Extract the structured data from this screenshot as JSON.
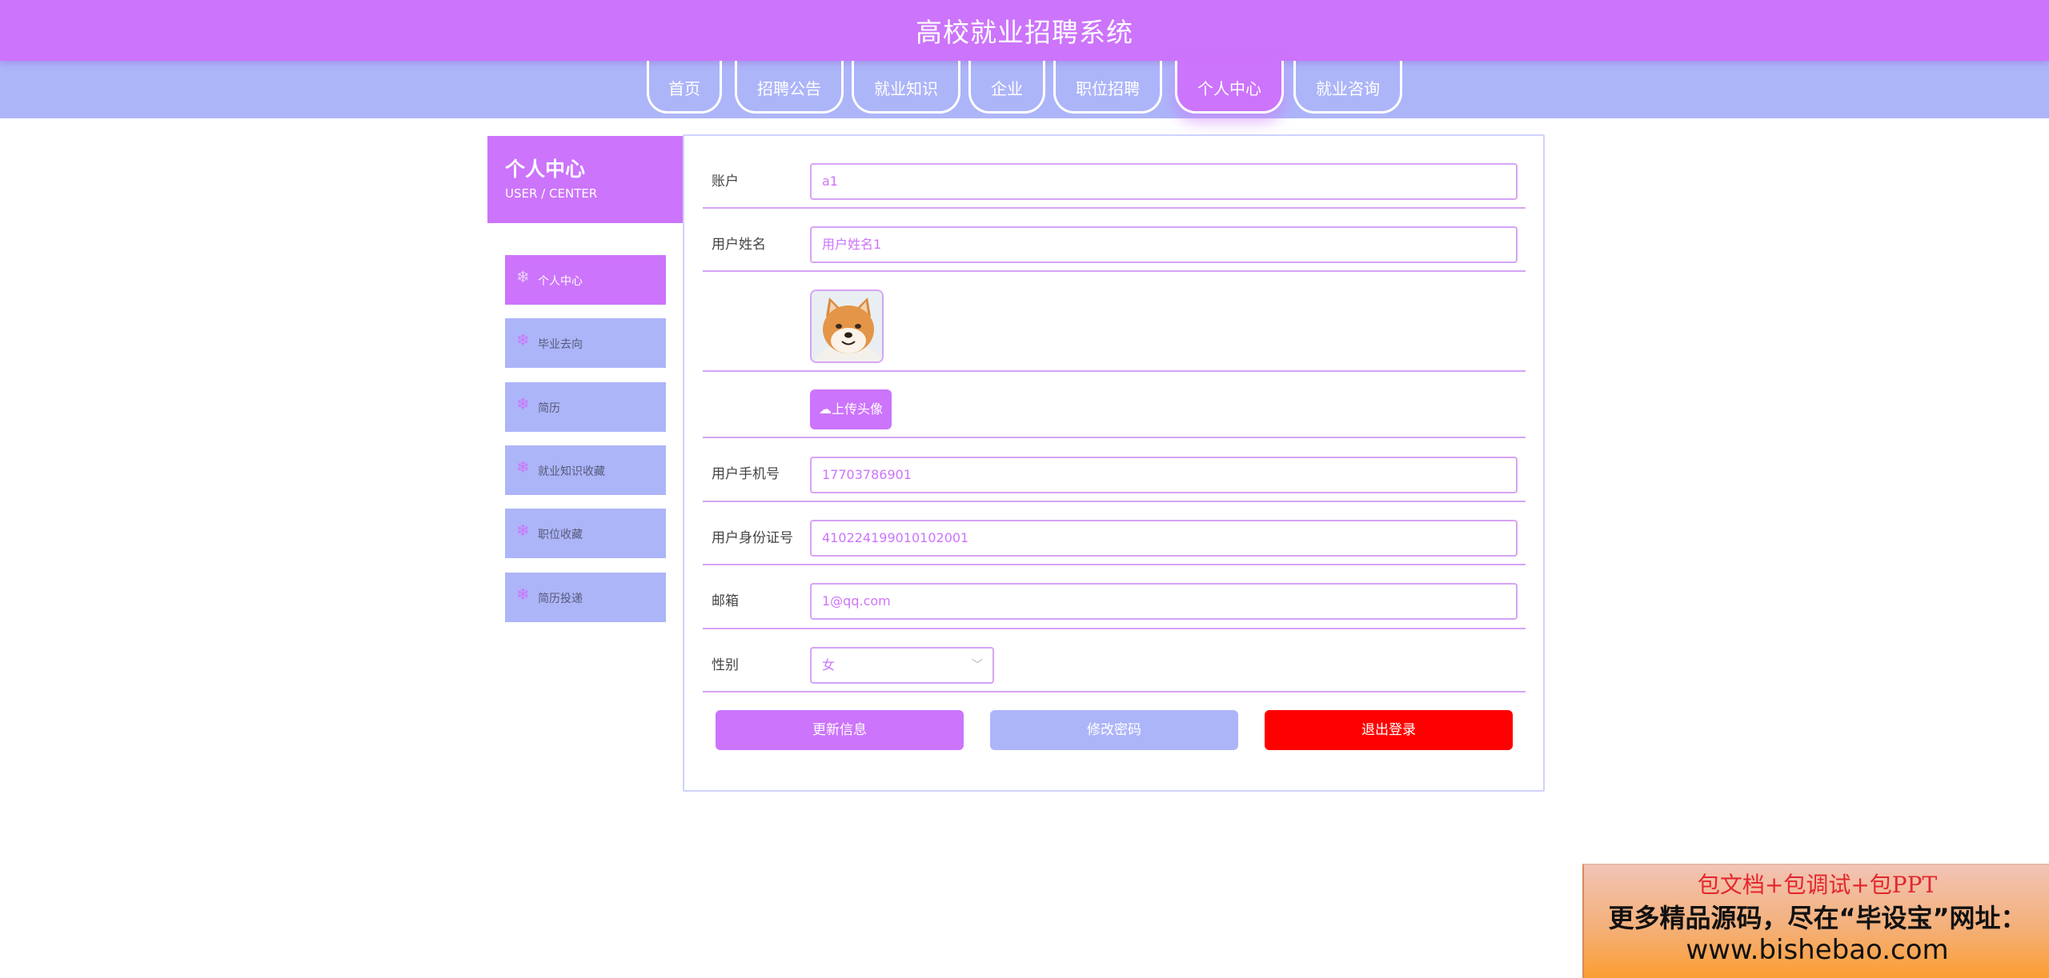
{
  "header": {
    "title": "高校就业招聘系统"
  },
  "nav": {
    "items": [
      {
        "label": "首页"
      },
      {
        "label": "招聘公告"
      },
      {
        "label": "就业知识"
      },
      {
        "label": "企业"
      },
      {
        "label": "职位招聘"
      },
      {
        "label": "个人中心",
        "active": true
      },
      {
        "label": "就业咨询"
      }
    ]
  },
  "sidebar": {
    "title": "个人中心",
    "subtitle": "USER / CENTER",
    "items": [
      {
        "label": "个人中心",
        "active": true,
        "icon": "snowflake-icon"
      },
      {
        "label": "毕业去向",
        "icon": "snowflake-icon"
      },
      {
        "label": "简历",
        "icon": "snowflake-icon"
      },
      {
        "label": "就业知识收藏",
        "icon": "snowflake-icon"
      },
      {
        "label": "职位收藏",
        "icon": "snowflake-icon"
      },
      {
        "label": "简历投递",
        "icon": "snowflake-icon"
      }
    ]
  },
  "form": {
    "account": {
      "label": "账户",
      "value": "a1"
    },
    "name": {
      "label": "用户姓名",
      "value": "用户姓名1"
    },
    "avatar": {
      "icon": "shiba-dog-avatar"
    },
    "upload": {
      "label": "上传头像",
      "icon": "cloud-upload-icon"
    },
    "phone": {
      "label": "用户手机号",
      "value": "17703786901"
    },
    "id_number": {
      "label": "用户身份证号",
      "value": "410224199010102001"
    },
    "email": {
      "label": "邮箱",
      "value": "1@qq.com"
    },
    "gender": {
      "label": "性别",
      "value": "女",
      "icon": "chevron-down-icon"
    }
  },
  "actions": {
    "update": "更新信息",
    "change_password": "修改密码",
    "logout": "退出登录"
  },
  "ad": {
    "line1": "包文档+包调试+包PPT",
    "line2": "更多精品源码，尽在“毕设宝”网址：",
    "line3": "www.bishebao.com"
  },
  "colors": {
    "primary": "#cc74fb",
    "secondary": "#adb5f9",
    "danger": "#ff0000"
  }
}
